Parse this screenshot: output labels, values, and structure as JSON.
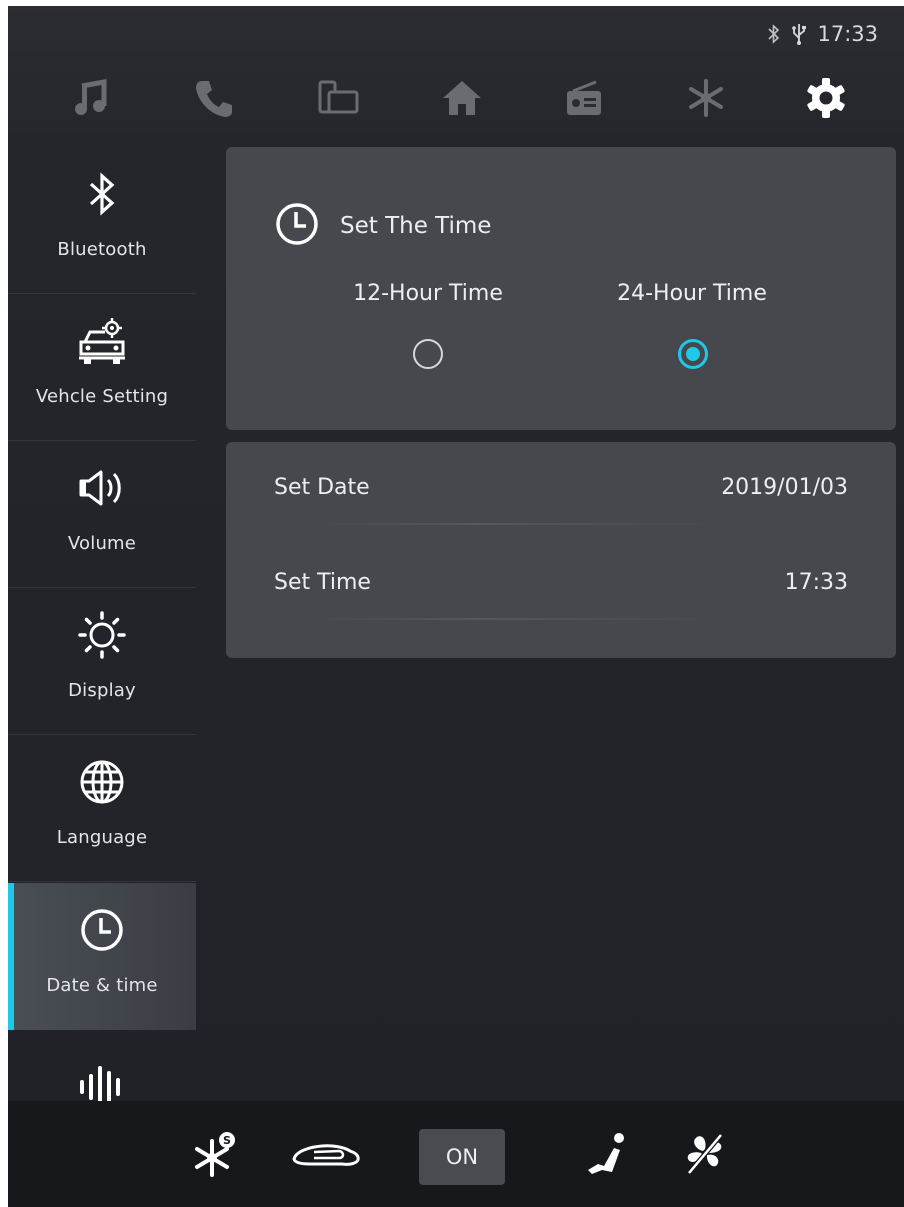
{
  "status": {
    "time": "17:33",
    "icons": [
      "bluetooth-icon",
      "usb-icon"
    ]
  },
  "top_nav": {
    "icons": [
      "music-icon",
      "phone-icon",
      "phone-link-icon",
      "home-icon",
      "radio-icon",
      "snowflake-icon",
      "settings-icon"
    ],
    "active": "settings-icon"
  },
  "sidebar": {
    "items": [
      {
        "label": "Bluetooth",
        "icon": "bluetooth-icon"
      },
      {
        "label": "Vehcle Setting",
        "icon": "car-settings-icon"
      },
      {
        "label": "Volume",
        "icon": "speaker-icon"
      },
      {
        "label": "Display",
        "icon": "brightness-icon"
      },
      {
        "label": "Language",
        "icon": "globe-icon"
      },
      {
        "label": "Date & time",
        "icon": "clock-icon"
      },
      {
        "label": "",
        "icon": "sound-wave-icon"
      }
    ],
    "active_index": 5
  },
  "time_format": {
    "title": "Set The Time",
    "option_12": "12-Hour Time",
    "option_24": "24-Hour Time",
    "selected": "24-Hour Time"
  },
  "date_time": {
    "date_label": "Set Date",
    "date_value": "2019/01/03",
    "time_label": "Set Time",
    "time_value": "17:33"
  },
  "bottom_bar": {
    "icons": [
      "ac-snowflake-icon",
      "car-icon",
      "seat-icon",
      "fan-off-icon"
    ],
    "ac_badge": "S",
    "on_label": "ON"
  },
  "colors": {
    "accent": "#1ec8e6",
    "background": "#202228",
    "panel": "#47484d",
    "bottom_bar": "#17181c"
  }
}
